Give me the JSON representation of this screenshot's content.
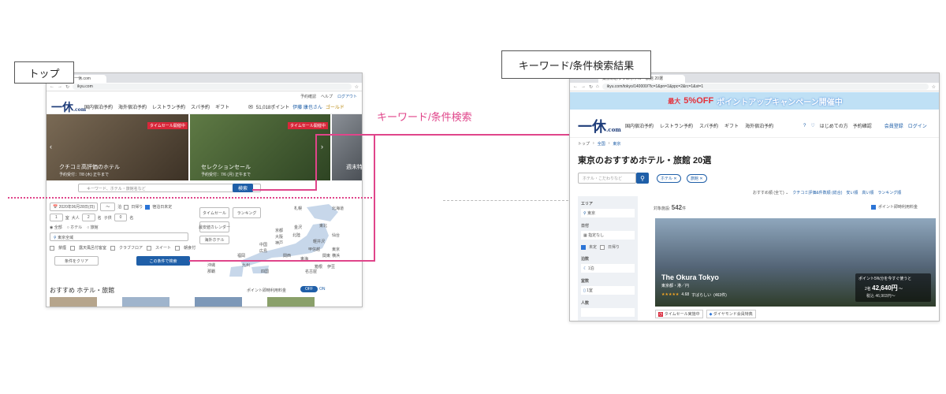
{
  "labels": {
    "top": "トップ",
    "results": "キーワード/条件検索結果",
    "arrow": "キーワード/条件検索"
  },
  "left": {
    "tab_title": "旅館予約 | 一休.com",
    "url": "ikyu.com",
    "header_links": [
      "予約確認",
      "ヘルプ",
      "ログアウト"
    ],
    "logo": "一休",
    "logo_suffix": ".com",
    "nav": [
      "国内宿泊予約",
      "海外宿泊予約",
      "レストラン予約",
      "スパ予約",
      "ギフト"
    ],
    "points": "51,018ポイント",
    "user": "伊藤 康也さん",
    "rank": "ゴールド",
    "hero": [
      {
        "title": "クチコミ高評価のホテル",
        "sub": "予約受付：7/8 (木) 正午まで",
        "tag": "タイムセール開催中"
      },
      {
        "title": "セレクションセール",
        "sub": "予約受付：7/6 (月) 正午まで",
        "tag": "タイムセール開催中"
      },
      {
        "title": "週末特",
        "sub": "",
        "tag": ""
      }
    ],
    "search_placeholder": "キーワード、ホテル・旅館名など",
    "search_button": "検索",
    "date": "2020年06月28日(日)",
    "day_trip": "日帰り",
    "undecided": "宿泊日未定",
    "nights": "1",
    "nights_unit": "泊",
    "rooms": "1",
    "rooms_unit": "室",
    "adults_label": "大人",
    "adults": "2",
    "adults_unit": "名",
    "children_label": "子供",
    "children": "0",
    "children_unit": "名",
    "radio": [
      "全部",
      "ホテル",
      "旅館"
    ],
    "area": "東京全域",
    "checks": [
      "禁煙",
      "露天風呂付客室",
      "クラブフロア",
      "スイート",
      "朝食付"
    ],
    "clear_button": "条件をクリア",
    "search_cond_button": "この条件で検索",
    "quick": [
      "タイムセール",
      "ランキング",
      "最安値カレンダー",
      "海外ホテル"
    ],
    "map_labels": [
      "札幌",
      "北海道",
      "仙台",
      "東京",
      "横浜",
      "京都",
      "大阪",
      "神戸",
      "広島",
      "福岡",
      "那覇",
      "名古屋",
      "金沢",
      "箱根",
      "伊豆",
      "軽井沢",
      "沖縄",
      "九州",
      "四国",
      "中国",
      "関西",
      "東海",
      "甲信越",
      "北陸",
      "関東",
      "東北"
    ],
    "section_title": "おすすめ ホテル・旅館",
    "point_toggle_label": "ポイント即時利用料金",
    "off": "OFF",
    "on": "ON"
  },
  "right": {
    "tab_title": "東京のおすすめホテル・旅館 20選",
    "url": "ikyu.com/tokyo/140000/?lc=1&pn=1&ppc=2&rc=1&st=1",
    "banner_prefix": "最大",
    "banner_pct": "5%OFF",
    "banner_text": "ポイントアップキャンペーン開催中",
    "logo": "一休",
    "logo_suffix": ".com",
    "nav": [
      "国内宿泊予約",
      "レストラン予約",
      "スパ予約",
      "ギフト",
      "海外宿泊予約"
    ],
    "header_links": [
      "はじめての方",
      "予約確認",
      "会員登録",
      "ログイン"
    ],
    "breadcrumb": [
      "トップ",
      "全国",
      "東京"
    ],
    "page_title": "東京のおすすめホテル・旅館 20選",
    "search_placeholder": "ホテル・こだわりなど",
    "chips": [
      "ホテル",
      "旅館"
    ],
    "sort_label": "おすすめ順 (全て)",
    "sort_options": [
      "クチコミ評価&件数順 (総合)",
      "安い順",
      "高い順",
      "ランキング順"
    ],
    "count_label": "対象施設:",
    "count": "542",
    "count_unit": "件",
    "point_toggle": "ポイント即時利用料金",
    "side": {
      "area_label": "エリア",
      "area_value": "東京",
      "date_label": "日付",
      "date_value": "指定なし",
      "undecided": "未定",
      "day_trip": "日帰り",
      "nights_label": "泊数",
      "nights_value": "1泊",
      "rooms_label": "室数",
      "rooms_value": "1室",
      "people_label": "人数"
    },
    "hotel": {
      "name": "The Okura Tokyo",
      "location": "東京都・港／円",
      "stars": "★★★★★",
      "rating": "4.68",
      "rating_word": "すばらしい",
      "reviews": "(463件)",
      "promo": "ポイント5%分を今すぐ使うと",
      "price_prefix": "2名",
      "price": "42,640円",
      "price_suffix": "〜",
      "tax": "税込 46,903円〜",
      "badges": [
        "タイムセール実施中",
        "ダイヤモンド会員特典"
      ]
    }
  },
  "colors": {
    "accent_pink": "#e0458a",
    "brand_blue": "#1f3d7a",
    "button_blue": "#1f5fa8"
  }
}
